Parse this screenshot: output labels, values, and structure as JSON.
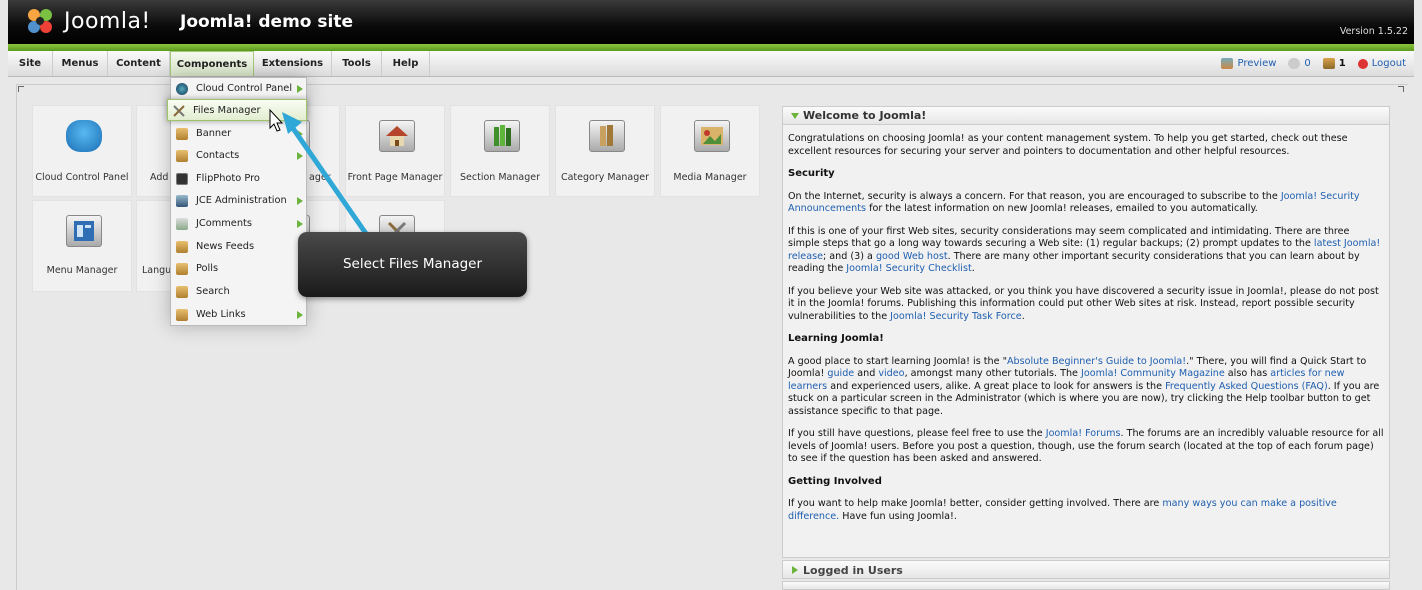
{
  "header": {
    "brand": "Joomla!",
    "site_name": "Joomla! demo site",
    "version": "Version 1.5.22"
  },
  "menubar": {
    "items": [
      "Site",
      "Menus",
      "Content",
      "Components",
      "Extensions",
      "Tools",
      "Help"
    ],
    "active": "Components",
    "preview": "Preview",
    "messages_count": "0",
    "users_count": "1",
    "logout": "Logout"
  },
  "tiles": [
    {
      "label": "Cloud Control Panel",
      "icon": "cloud-icon"
    },
    {
      "label": "Add",
      "icon": "add-article-icon"
    },
    {
      "label": "ager",
      "icon": "article-manager-icon"
    },
    {
      "label": "Front Page Manager",
      "icon": "front-page-icon"
    },
    {
      "label": "Section Manager",
      "icon": "section-icon"
    },
    {
      "label": "Category Manager",
      "icon": "category-icon"
    },
    {
      "label": "Media Manager",
      "icon": "media-icon"
    },
    {
      "label": "Menu Manager",
      "icon": "menu-manager-icon"
    },
    {
      "label": "Langu",
      "icon": "language-icon"
    },
    {
      "label": "",
      "icon": "user-manager-icon"
    },
    {
      "label": "",
      "icon": "global-config-icon"
    }
  ],
  "dropdown": {
    "items": [
      {
        "label": "Cloud Control Panel",
        "icon": "cloud-icon",
        "submenu": true
      },
      {
        "label": "Files Manager",
        "icon": "files-manager-icon",
        "submenu": false
      },
      {
        "label": "Banner",
        "icon": "banner-icon",
        "submenu": true
      },
      {
        "label": "Contacts",
        "icon": "contacts-icon",
        "submenu": true
      },
      {
        "label": "FlipPhoto Pro",
        "icon": "flipphoto-icon",
        "submenu": false
      },
      {
        "label": "JCE Administration",
        "icon": "jce-icon",
        "submenu": true
      },
      {
        "label": "JComments",
        "icon": "jcomments-icon",
        "submenu": true
      },
      {
        "label": "News Feeds",
        "icon": "newsfeeds-icon",
        "submenu": false
      },
      {
        "label": "Polls",
        "icon": "polls-icon",
        "submenu": false
      },
      {
        "label": "Search",
        "icon": "search-icon",
        "submenu": false
      },
      {
        "label": "Web Links",
        "icon": "weblinks-icon",
        "submenu": true
      }
    ],
    "highlighted": "Files Manager"
  },
  "callout": {
    "text": "Select Files Manager"
  },
  "welcome": {
    "title": "Welcome to Joomla!",
    "intro": "Congratulations on choosing Joomla! as your content management system. To help you get started, check out these excellent resources for securing your server and pointers to documentation and other helpful resources.",
    "security_heading": "Security",
    "sec_p1_a": "On the Internet, security is always a concern. For that reason, you are encouraged to subscribe to the ",
    "sec_p1_link": "Joomla! Security Announcements",
    "sec_p1_b": " for the latest information on new Joomla! releases, emailed to you automatically.",
    "sec_p2_a": "If this is one of your first Web sites, security considerations may seem complicated and intimidating. There are three simple steps that go a long way towards securing a Web site: (1) regular backups; (2) prompt updates to the ",
    "sec_p2_link1": "latest Joomla! release",
    "sec_p2_b": "; and (3) a ",
    "sec_p2_link2": "good Web host",
    "sec_p2_c": ". There are many other important security considerations that you can learn about by reading the ",
    "sec_p2_link3": "Joomla! Security Checklist",
    "sec_p2_d": ".",
    "sec_p3_a": "If you believe your Web site was attacked, or you think you have discovered a security issue in Joomla!, please do not post it in the Joomla! forums. Publishing this information could put other Web sites at risk. Instead, report possible security vulnerabilities to the ",
    "sec_p3_link": "Joomla! Security Task Force",
    "sec_p3_b": ".",
    "learning_heading": "Learning Joomla!",
    "learn_p1_a": "A good place to start learning Joomla! is the \"",
    "learn_p1_link1": "Absolute Beginner's Guide to Joomla!",
    "learn_p1_b": ".\" There, you will find a Quick Start to Joomla! ",
    "learn_p1_link2": "guide",
    "learn_p1_c": " and ",
    "learn_p1_link3": "video",
    "learn_p1_d": ", amongst many other tutorials. The ",
    "learn_p1_link4": "Joomla! Community Magazine",
    "learn_p1_e": " also has ",
    "learn_p1_link5": "articles for new learners",
    "learn_p1_f": " and experienced users, alike. A great place to look for answers is the ",
    "learn_p1_link6": "Frequently Asked Questions (FAQ)",
    "learn_p1_g": ". If you are stuck on a particular screen in the Administrator (which is where you are now), try clicking the Help toolbar button to get assistance specific to that page.",
    "learn_p2_a": "If you still have questions, please feel free to use the ",
    "learn_p2_link": "Joomla! Forums",
    "learn_p2_b": ". The forums are an incredibly valuable resource for all levels of Joomla! users. Before you post a question, though, use the forum search (located at the top of each forum page) to see if the question has been asked and answered.",
    "involved_heading": "Getting Involved",
    "inv_p1_a": "If you want to help make Joomla! better, consider getting involved. There are ",
    "inv_p1_link": "many ways you can make a positive difference.",
    "inv_p1_b": " Have fun using Joomla!."
  },
  "logged_in_users": {
    "title": "Logged in Users"
  }
}
